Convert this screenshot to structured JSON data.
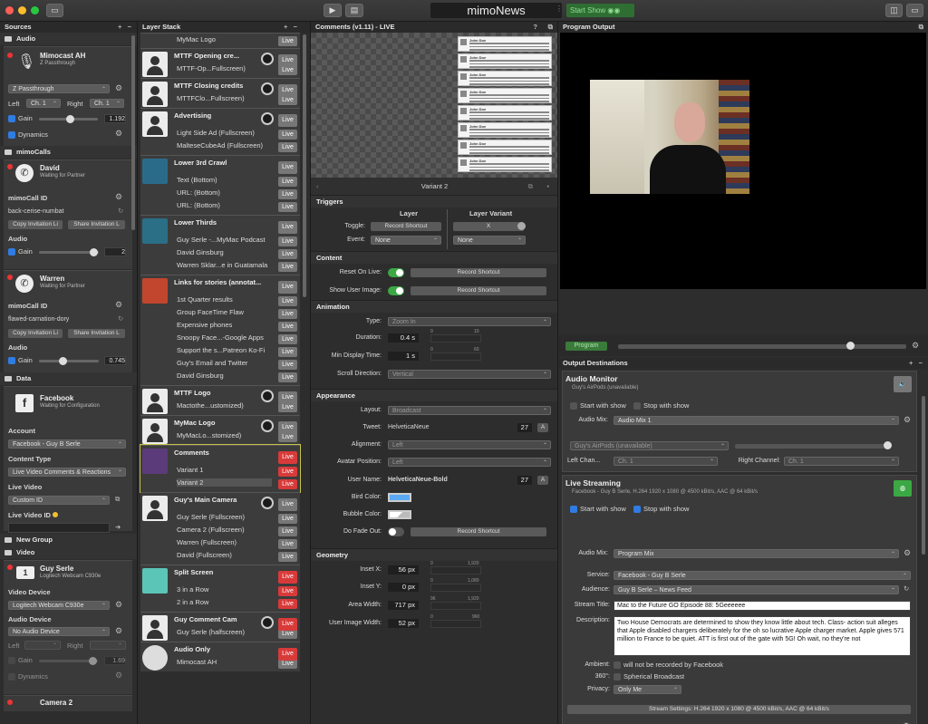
{
  "app": {
    "title": "mimoNews",
    "start_show": "Start Show"
  },
  "sources": {
    "header": "Sources",
    "add": "+",
    "remove": "−",
    "audio": {
      "group": "Audio",
      "name": "Mimocast AH",
      "sub": "Z Passthrough",
      "device": "Z Passthrough",
      "left": "Left",
      "right": "Right",
      "left_ch": "Ch. 1",
      "right_ch": "Ch. 1",
      "gain": "Gain",
      "gain_value": "1.192",
      "dynamics": "Dynamics"
    },
    "mimocalls": {
      "group": "mimoCalls",
      "calls": [
        {
          "name": "David",
          "status": "Waiting for Partner",
          "id_label": "mimoCall ID",
          "id": "back-cerise-numbat",
          "copy": "Copy Invitation Li",
          "share": "Share Invitation L",
          "audio": "Audio",
          "gain": "Gain",
          "gain_value": "2"
        },
        {
          "name": "Warren",
          "status": "Waiting for Partner",
          "id_label": "mimoCall ID",
          "id": "flawed-carnation-dory",
          "copy": "Copy Invitation Li",
          "share": "Share Invitation L",
          "audio": "Audio",
          "gain": "Gain",
          "gain_value": "0.745"
        }
      ]
    },
    "data": {
      "group": "Data",
      "name": "Facebook",
      "status": "Waiting for Configuration",
      "account_label": "Account",
      "account": "Facebook - Guy B Serle",
      "content_label": "Content Type",
      "content": "Live Video Comments & Reactions",
      "live_video_label": "Live Video",
      "live_video": "Custom ID",
      "live_video_id_label": "Live Video ID"
    },
    "new_group": "New Group",
    "video": {
      "group": "Video",
      "name": "Guy Serle",
      "sub": "Logitech Webcam C930e",
      "vdev_label": "Video Device",
      "vdev": "Logitech Webcam C930e",
      "adev_label": "Audio Device",
      "adev": "No Audio Device",
      "left": "Left",
      "right": "Right",
      "gain": "Gain",
      "gain_value": "1.69",
      "dynamics": "Dynamics"
    },
    "camera2": "Camera 2"
  },
  "layers": {
    "header": "Layer Stack",
    "add": "+",
    "remove": "−",
    "live": "Live",
    "items": [
      {
        "sub": "MyMac Logo"
      },
      {
        "title": "MTTF Opening cre...",
        "sub": "MTTF-Op...Fullscreen)"
      },
      {
        "title": "MTTF Closing credits",
        "sub": "MTTFClo...Fullscreen)"
      },
      {
        "title": "Advertising",
        "subs": [
          "Light Side Ad (Fullscreen)",
          "MalteseCubeAd (Fullscreen)"
        ]
      },
      {
        "title": "Lower 3rd Crawl",
        "subs": [
          "Text (Bottom)",
          "URL: (Bottom)",
          "URL: (Bottom)"
        ]
      },
      {
        "title": "Lower Thirds",
        "subs": [
          "Guy Serle -...MyMac Podcast",
          "David Ginsburg",
          "Warren Sklar...e in Guatamala"
        ]
      },
      {
        "title": "Links for stories (annotat...",
        "subs": [
          "1st Quarter results",
          "Group FaceTime Flaw",
          "Expensive phones",
          "Snoopy Face...-Google Apps",
          "Support the s...Patreon Ko-Fi",
          "Guy's Email and Twitter",
          "David Ginsburg"
        ]
      },
      {
        "title": "MTTF Logo",
        "sub": "Mactothe...ustomized)"
      },
      {
        "title": "MyMac Logo",
        "sub": "MyMacLo...stomized)"
      },
      {
        "title": "Comments",
        "subs": [
          "Variant 1",
          "Variant 2"
        ]
      },
      {
        "title": "Guy's Main Camera",
        "subs": [
          "Guy Serle (Fullscreen)",
          "Camera 2 (Fullscreen)",
          "Warren (Fullscreen)",
          "David (Fullscreen)"
        ]
      },
      {
        "title": "Split Screen",
        "subs": [
          "3 in a Row",
          "2 in a Row"
        ]
      },
      {
        "title": "Guy Comment Cam",
        "sub": "Guy Serle (halfscreen)"
      },
      {
        "title": "Audio Only",
        "sub": "Mimocast AH"
      }
    ]
  },
  "comments": {
    "header": "Comments (v1.11) - LIVE",
    "variant": "Variant 2",
    "triggers": {
      "title": "Triggers",
      "layer": "Layer",
      "variant": "Layer Variant",
      "toggle": "Toggle:",
      "toggle_val": "Record Shortcut",
      "toggle_var": "X",
      "event": "Event:",
      "event_val": "None",
      "event_var": "None"
    },
    "content": {
      "title": "Content",
      "reset": "Reset On Live:",
      "show_user": "Show User Image:",
      "record": "Record Shortcut"
    },
    "animation": {
      "title": "Animation",
      "type_l": "Type:",
      "type": "Zoom In",
      "dur_l": "Duration:",
      "dur": "0.4 s",
      "min_l": "Min Display Time:",
      "min": "1 s",
      "scroll_l": "Scroll Direction:",
      "scroll": "Vertical",
      "s0": "0",
      "s10": "10",
      "s60": "60"
    },
    "appearance": {
      "title": "Appearance",
      "layout_l": "Layout:",
      "layout": "Broadcast",
      "tweet_l": "Tweet:",
      "tweet_font": "HelveticaNeue",
      "tweet_size": "27",
      "align_l": "Alignment:",
      "align": "Left",
      "avatar_l": "Avatar Position:",
      "avatar": "Left",
      "user_l": "User Name:",
      "user_font": "HelveticaNeue-Bold",
      "user_size": "27",
      "bird_l": "Bird Color:",
      "bubble_l": "Bubble Color:",
      "fade_l": "Do Fade Out:",
      "record": "Record Shortcut",
      "font_btn": "A"
    },
    "geometry": {
      "title": "Geometry",
      "ix_l": "Inset X:",
      "ix": "56 px",
      "iy_l": "Inset Y:",
      "iy": "0 px",
      "aw_l": "Area Width:",
      "aw": "717 px",
      "uw_l": "User Image Width:",
      "uw": "52 px",
      "s0": "0",
      "s1920": "1,920",
      "s1080": "1,080",
      "s96": "96",
      "s960": "960"
    },
    "preview_name": "John Doe"
  },
  "program": {
    "header": "Program Output",
    "button": "Program"
  },
  "outputs": {
    "header": "Output Destinations",
    "add": "+",
    "remove": "−",
    "monitor": {
      "title": "Audio Monitor",
      "sub": "Guy's AirPods (unavailable)",
      "start": "Start with show",
      "stop": "Stop with show",
      "mix_l": "Audio Mix:",
      "mix": "Audio Mix 1",
      "device": "Guy's AirPods (unavailable)",
      "left_l": "Left Chan...",
      "left": "Ch. 1",
      "right_l": "Right Channel:",
      "right": "Ch. 1"
    },
    "stream": {
      "title": "Live Streaming",
      "sub": "Facebook - Guy B Serle, H.264 1920 x 1080 @ 4500 kBit/s, AAC @ 64 kBit/s",
      "start": "Start with show",
      "stop": "Stop with show",
      "mix_l": "Audio Mix:",
      "mix": "Program Mix",
      "service_l": "Service:",
      "service": "Facebook - Guy B Serle",
      "audience_l": "Audience:",
      "audience": "Guy B Serle – News Feed",
      "title_l": "Stream Title:",
      "title_v": "Mac to the Future GO Episode 88: 5Geeeeee",
      "desc_l": "Description:",
      "desc": "Two House Democrats are determined to show they know little about tech. Class- action suit alleges that Apple disabled chargers deliberately for the oh so lucrative Apple charger market. Apple gives 571 million to France to be quiet. ATT is first out of the gate with 5G! Oh wait, no they're not",
      "ambient_l": "Ambient:",
      "ambient": "will not be recorded by Facebook",
      "deg_l": "360°:",
      "deg": "Spherical Broadcast",
      "privacy_l": "Privacy:",
      "privacy": "Only Me",
      "settings": "Stream Settings: H.264 1920 x 1080 @ 4500 kBit/s, AAC @ 64 kBit/s",
      "help": "?"
    }
  }
}
